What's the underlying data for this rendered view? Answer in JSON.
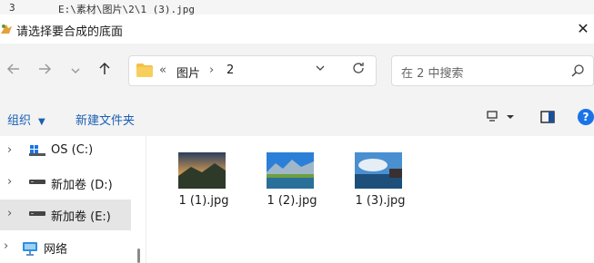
{
  "background": {
    "line_number": "3",
    "line_text": "E:\\素材\\图片\\2\\1 (3).jpg"
  },
  "dialog": {
    "title": "请选择要合成的底面",
    "close_symbol": "✕"
  },
  "address": {
    "overflow": "«",
    "crumbs": [
      "图片",
      "2"
    ],
    "separator": "›"
  },
  "search": {
    "placeholder": "在 2 中搜索"
  },
  "toolbar": {
    "organize": "组织",
    "new_folder": "新建文件夹"
  },
  "sidebar": {
    "items": [
      {
        "label": "OS (C:)",
        "icon": "os-drive-icon",
        "selected": false
      },
      {
        "label": "新加卷 (D:)",
        "icon": "drive-icon",
        "selected": false
      },
      {
        "label": "新加卷 (E:)",
        "icon": "drive-icon",
        "selected": true
      },
      {
        "label": "网络",
        "icon": "network-icon",
        "selected": false
      }
    ]
  },
  "files": [
    {
      "name": "1 (1).jpg"
    },
    {
      "name": "1 (2).jpg"
    },
    {
      "name": "1 (3).jpg"
    }
  ],
  "colors": {
    "accent": "#1a73e8",
    "link": "#1a5fb4",
    "folder": "#f4c14a"
  }
}
